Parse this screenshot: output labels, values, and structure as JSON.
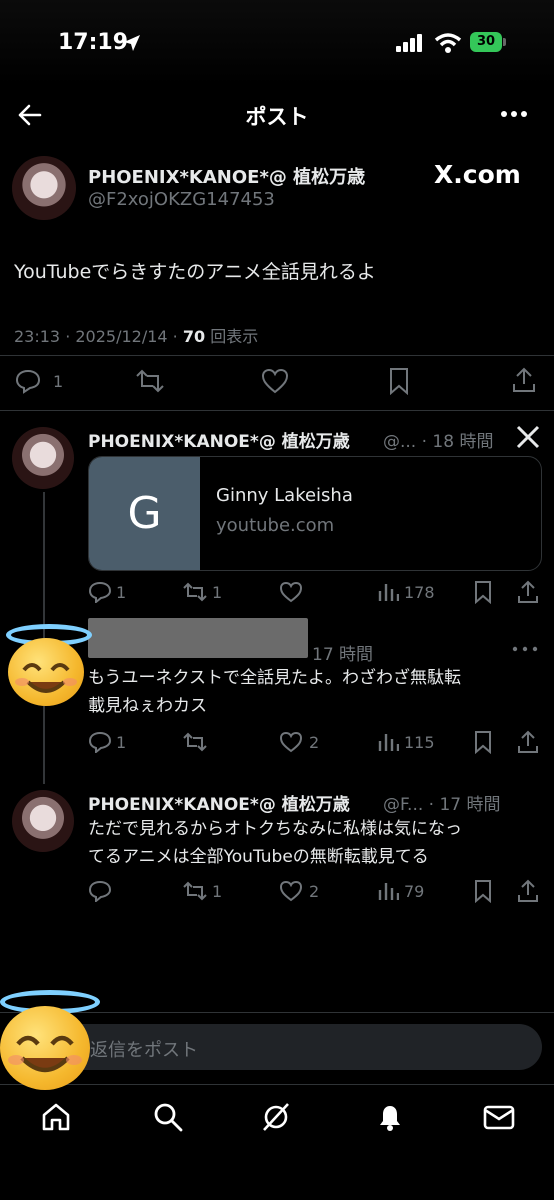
{
  "status_bar": {
    "time": "17:19",
    "battery": "30"
  },
  "nav": {
    "title": "ポスト"
  },
  "main_post": {
    "author_name": "PHOENIX*KANOE*@ 植松万歳",
    "handle": "@F2xojOKZG147453",
    "watermark": "X.com",
    "text": "YouTubeでらきすたのアニメ全話見れるよ",
    "meta_prefix": "23:13 · 2025/12/14 · ",
    "views": "70",
    "views_suffix": "回表示",
    "replies": "1"
  },
  "reply1": {
    "author_name": "PHOENIX*KANOE*@ 植松万歳",
    "handle_time": "@... · 18 時間",
    "card_letter": "G",
    "card_title": "Ginny Lakeisha",
    "card_domain": "youtube.com",
    "replies": "1",
    "reposts": "1",
    "views": "178"
  },
  "reply2": {
    "time": "17 時間",
    "text_line1": "もうユーネクストで全話見たよ。わざわざ無駄転",
    "text_line2": "載見ねぇわカス",
    "replies": "1",
    "likes": "2",
    "views": "115"
  },
  "reply3": {
    "author_name": "PHOENIX*KANOE*@ 植松万歳",
    "handle_time": "@F... · 17 時間",
    "text_line1": "ただで見れるからオトクちなみに私様は気になっ",
    "text_line2": "てるアニメは全部YouTubeの無断転載見てる",
    "reposts": "1",
    "likes": "2",
    "views": "79"
  },
  "composer": {
    "placeholder": "返信をポスト"
  },
  "icons": {
    "back": "back-arrow-icon",
    "more": "more-icon",
    "reply": "reply-icon",
    "repost": "repost-icon",
    "like": "like-icon",
    "bookmark": "bookmark-icon",
    "share": "share-icon",
    "views": "views-icon",
    "home": "home-icon",
    "search": "search-icon",
    "grok": "grok-icon",
    "notifications": "bell-icon",
    "messages": "mail-icon",
    "x_logo": "x-logo-icon",
    "emoji": "smiling-face-with-halo-icon"
  },
  "colors": {
    "background": "#000000",
    "text": "#e7e9ea",
    "muted": "#71767b",
    "divider": "#2f3336",
    "battery": "#34c759"
  }
}
